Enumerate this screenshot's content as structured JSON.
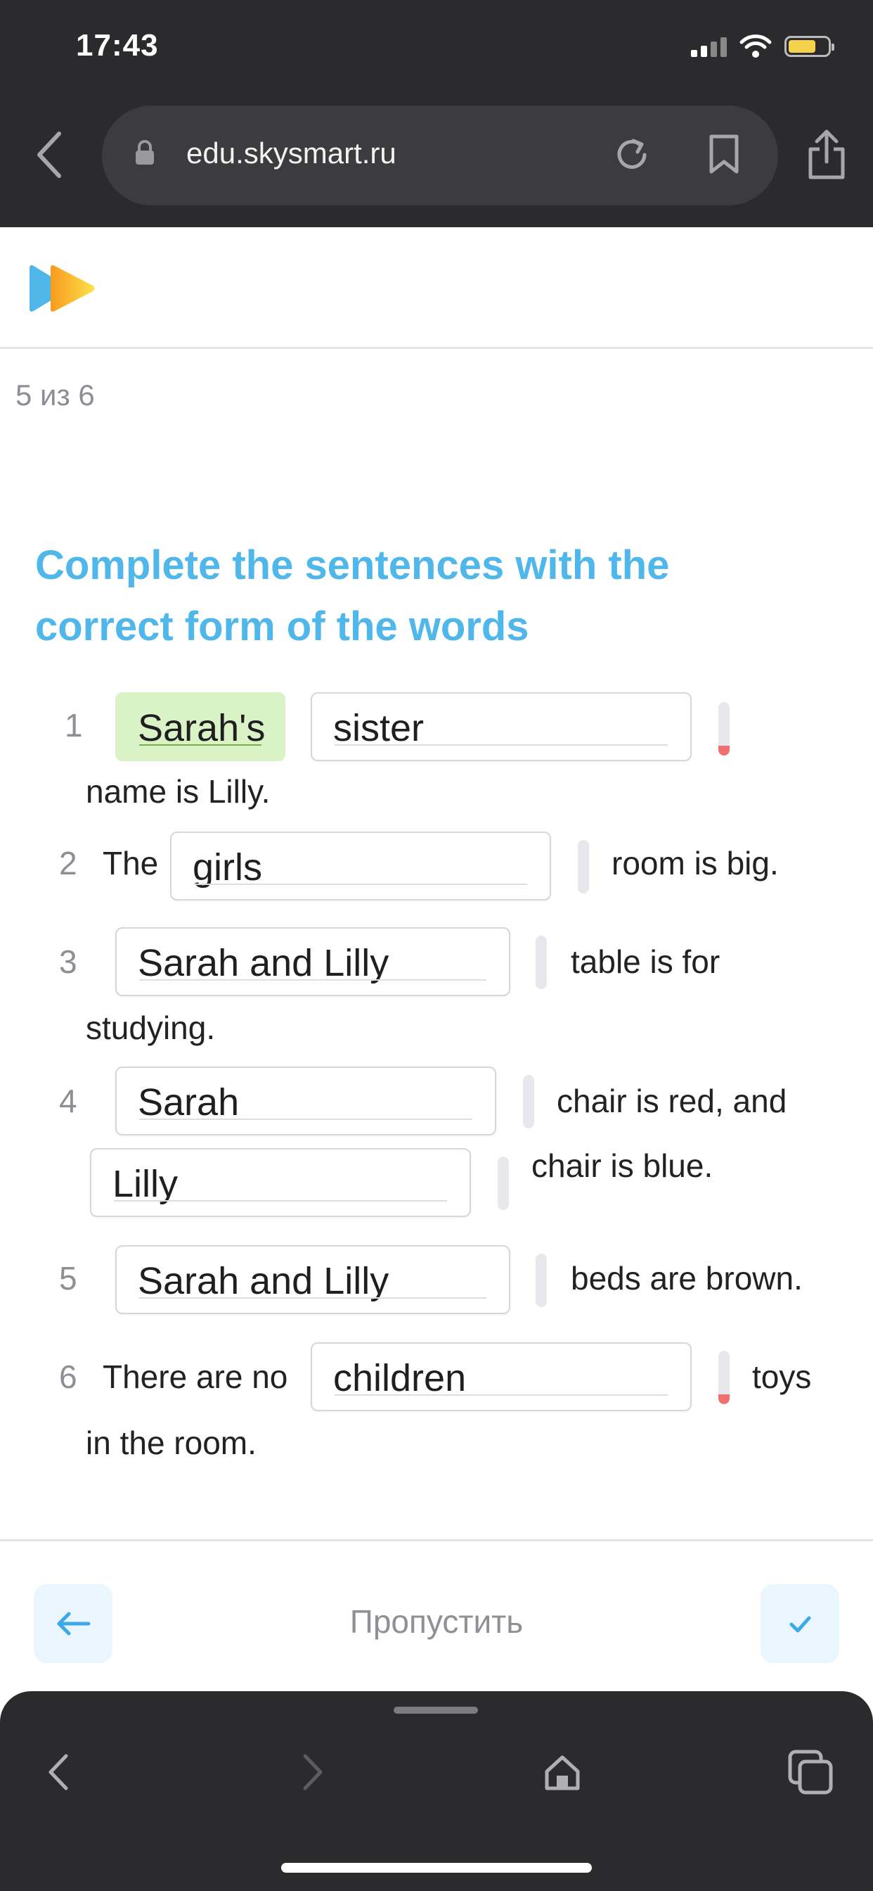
{
  "status_bar": {
    "time": "17:43"
  },
  "browser": {
    "url": "edu.skysmart.ru",
    "icons": [
      "back-arrow-icon",
      "lock-icon",
      "reload-icon",
      "bookmark-icon",
      "share-icon"
    ]
  },
  "header": {
    "progress": "5 из 6"
  },
  "exercise": {
    "title": "Complete the sentences with the correct form of the words",
    "items": [
      {
        "number": "1",
        "answer": "Sarah's",
        "word": "sister",
        "after": "name is Lilly."
      },
      {
        "number": "2",
        "before": "The",
        "word": "girls",
        "after": "room is big."
      },
      {
        "number": "3",
        "word": "Sarah and Lilly",
        "after_line1": "table is for",
        "after_line2": "studying."
      },
      {
        "number": "4",
        "word1": "Sarah",
        "after1": "chair is red, and",
        "word2": "Lilly",
        "after2": "chair is blue."
      },
      {
        "number": "5",
        "word": "Sarah and Lilly",
        "after": "beds are brown."
      },
      {
        "number": "6",
        "before": "There are no",
        "word": "children",
        "after_line1": "toys",
        "after_line2": "in the room."
      }
    ]
  },
  "footer": {
    "skip_label": "Пропустить"
  },
  "colors": {
    "accent": "#4fb7ea",
    "filled_answer_bg": "#d9f3c7",
    "error_marker": "#f06f6f",
    "chrome_bg": "#2b2b2d"
  }
}
